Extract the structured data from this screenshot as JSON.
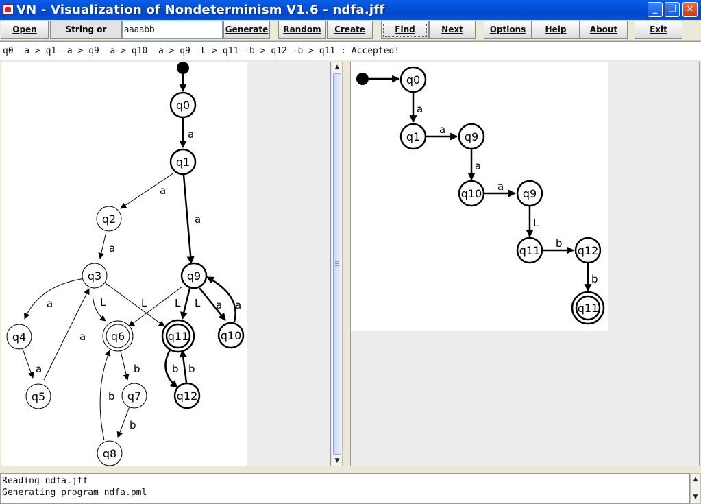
{
  "window": {
    "title": "VN - Visualization of Nondeterminism V1.6 - ndfa.jff",
    "minimize_glyph": "_",
    "maximize_glyph": "❐",
    "close_glyph": "✕"
  },
  "toolbar": {
    "open_label": "Open",
    "string_label": "String or length:",
    "string_value": "aaaabb",
    "generate_label": "Generate",
    "random_label": "Random",
    "create_label": "Create",
    "find_label": "Find",
    "next_label": "Next",
    "options_label": "Options",
    "help_label": "Help",
    "about_label": "About",
    "exit_label": "Exit"
  },
  "path_text": "q0 -a-> q1 -a-> q9 -a-> q10 -a-> q9 -L-> q11 -b-> q12 -b-> q11 : Accepted!",
  "left_graph": {
    "states": {
      "q0": "q0",
      "q1": "q1",
      "q2": "q2",
      "q3": "q3",
      "q4": "q4",
      "q5": "q5",
      "q6": "q6",
      "q7": "q7",
      "q8": "q8",
      "q9": "q9",
      "q10": "q10",
      "q11": "q11",
      "q12": "q12"
    },
    "edge_labels": {
      "q0_q1": "a",
      "q1_q2": "a",
      "q1_q9": "a",
      "q2_q3": "a",
      "q3_q4": "a",
      "q3_q6": "L",
      "q3_q11": "L",
      "q4_q5": "a",
      "q5_q3": "a",
      "q6_q7": "b",
      "q7_q8": "b",
      "q8_q6": "b",
      "q9_q6": "L",
      "q9_q11": "L",
      "q9_q10": "a",
      "q10_q9": "a",
      "q11_q12": "b",
      "q12_q11": "b"
    }
  },
  "right_graph": {
    "states": [
      "q0",
      "q1",
      "q9",
      "q10",
      "q9",
      "q11",
      "q12",
      "q11"
    ],
    "edge_labels": [
      "a",
      "a",
      "a",
      "a",
      "L",
      "b",
      "b"
    ]
  },
  "console": {
    "lines": [
      "Reading ndfa.jff",
      "Generating program ndfa.pml"
    ]
  },
  "scroll": {
    "up_glyph": "▲",
    "down_glyph": "▼"
  }
}
